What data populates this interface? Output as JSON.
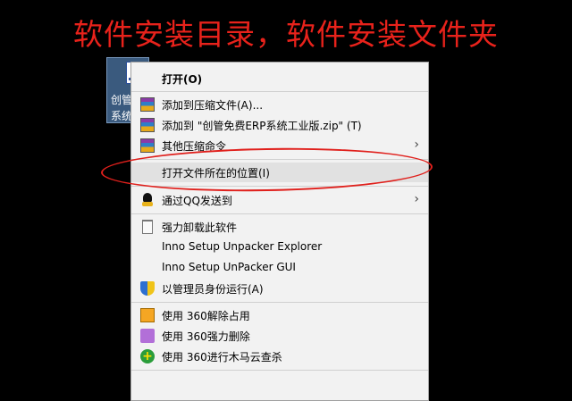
{
  "banner": {
    "title": "软件安装目录，软件安装文件夹"
  },
  "desktop_icon": {
    "label_line1": "创管",
    "label_line2": "系统"
  },
  "menu": {
    "items": [
      {
        "label": "打开(O)"
      },
      {
        "label": "添加到压缩文件(A)..."
      },
      {
        "label": "添加到 \"创管免费ERP系统工业版.zip\" (T)"
      },
      {
        "label": "其他压缩命令"
      },
      {
        "label": "打开文件所在的位置(I)"
      },
      {
        "label": "通过QQ发送到"
      },
      {
        "label": "强力卸载此软件"
      },
      {
        "label": "Inno Setup Unpacker Explorer"
      },
      {
        "label": "Inno Setup UnPacker GUI"
      },
      {
        "label": "以管理员身份运行(A)"
      },
      {
        "label": "使用 360解除占用"
      },
      {
        "label": "使用 360强力删除"
      },
      {
        "label": "使用 360进行木马云查杀"
      }
    ],
    "submenu_arrow": "›"
  },
  "colors": {
    "banner": "#e8221b",
    "annotation": "#e0201c",
    "menu_bg": "#f2f2f2",
    "highlight": "#e1e1e1"
  }
}
